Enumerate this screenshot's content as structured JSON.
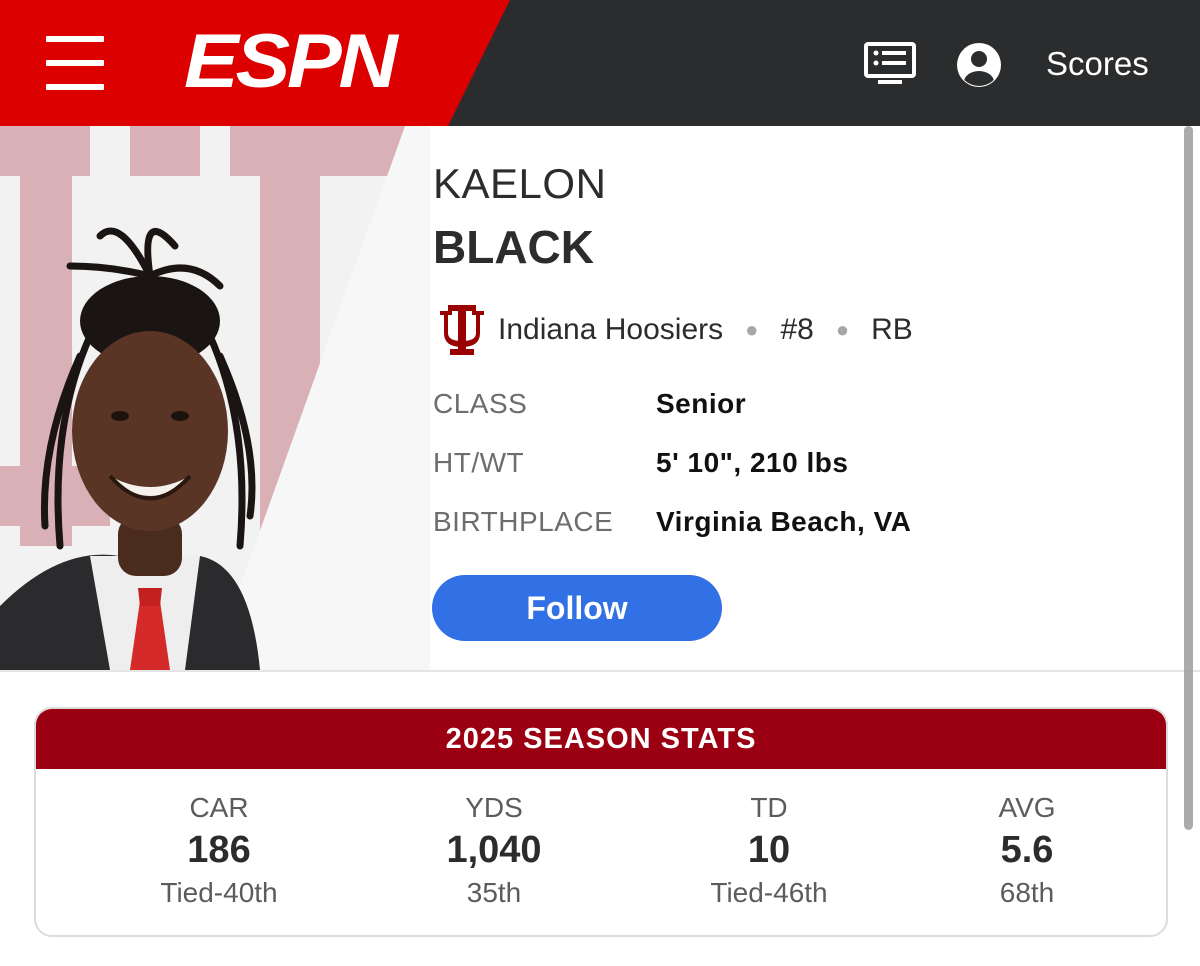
{
  "nav": {
    "brand": "ESPN",
    "menu_icon": "hamburger-menu-icon",
    "list_icon": "scores-list-icon",
    "account_icon": "user-account-icon",
    "scores_label": "Scores",
    "colors": {
      "brand_red": "#dd0000",
      "bar": "#2b2c2d"
    }
  },
  "player": {
    "first_name": "KAELON",
    "last_name": "BLACK",
    "team": "Indiana Hoosiers",
    "team_logo": "indiana-iu-logo-icon",
    "number": "#8",
    "position": "RB",
    "bio": [
      {
        "label": "CLASS",
        "value": "Senior"
      },
      {
        "label": "HT/WT",
        "value": "5' 10\", 210 lbs"
      },
      {
        "label": "BIRTHPLACE",
        "value": "Virginia Beach, VA"
      }
    ],
    "follow_label": "Follow"
  },
  "stats": {
    "title": "2025 SEASON STATS",
    "items": [
      {
        "label": "CAR",
        "value": "186",
        "rank": "Tied-40th"
      },
      {
        "label": "YDS",
        "value": "1,040",
        "rank": "35th"
      },
      {
        "label": "TD",
        "value": "10",
        "rank": "Tied-46th"
      },
      {
        "label": "AVG",
        "value": "5.6",
        "rank": "68th"
      }
    ],
    "colors": {
      "header": "#9a0011"
    }
  }
}
